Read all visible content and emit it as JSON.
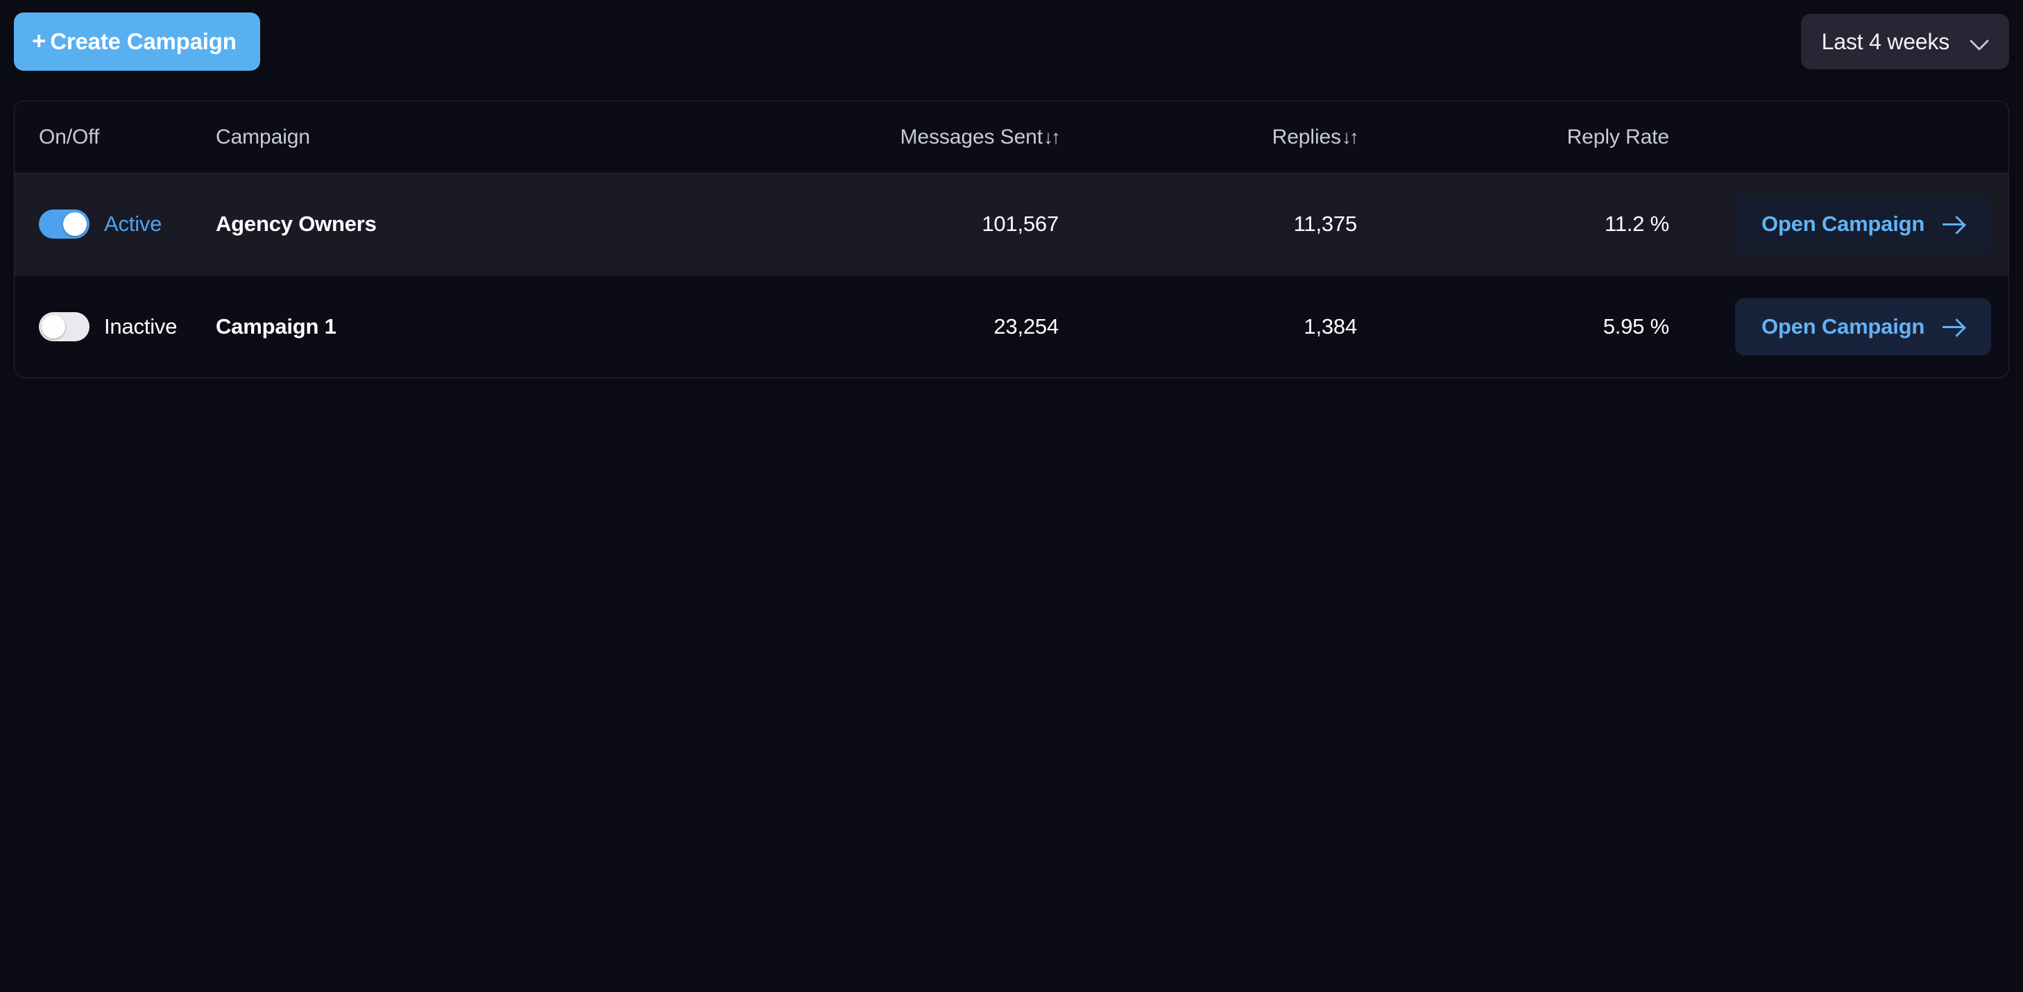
{
  "toolbar": {
    "create_campaign_label": "Create Campaign",
    "create_campaign_plus": "+",
    "date_filter_value": "Last 4 weeks"
  },
  "table": {
    "columns": [
      {
        "key": "onoff",
        "label": "On/Off",
        "sort_icon": ""
      },
      {
        "key": "campaign",
        "label": "Campaign",
        "sort_icon": ""
      },
      {
        "key": "sent",
        "label": "Messages Sent",
        "sort_icon": "↓↑"
      },
      {
        "key": "replies",
        "label": "Replies",
        "sort_icon": "↓↑"
      },
      {
        "key": "rate",
        "label": "Reply Rate",
        "sort_icon": ""
      }
    ],
    "rows": [
      {
        "state_label": "Active",
        "state_on": true,
        "campaign": "Agency Owners",
        "messages_sent": "101,567",
        "replies": "11,375",
        "reply_rate": "11.2 %",
        "open_label": "Open Campaign"
      },
      {
        "state_label": "Inactive",
        "state_on": false,
        "campaign": "Campaign 1",
        "messages_sent": "23,254",
        "replies": "1,384",
        "reply_rate": "5.95 %",
        "open_label": "Open Campaign"
      }
    ]
  },
  "colors": {
    "page_bg": "#0b0b14",
    "accent_blue": "#58b0f0",
    "link_blue": "#62b3f3",
    "row_alt_bg": "#1a1a25",
    "card_border": "#26263a",
    "dropdown_bg": "#262634",
    "header_text": "#c8cbd4"
  }
}
